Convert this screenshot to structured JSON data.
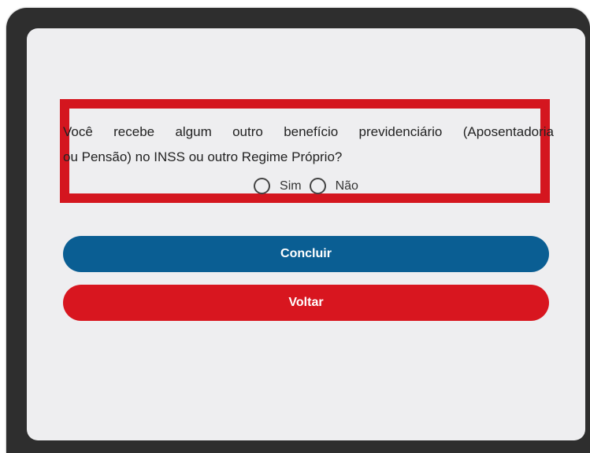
{
  "form": {
    "question_line1": "Você recebe algum outro benefício previdenciário (Aposentadoria",
    "question_line2": "ou Pensão) no INSS ou outro Regime Próprio?",
    "options": [
      {
        "label": "Sim",
        "selected": false
      },
      {
        "label": "Não",
        "selected": false
      }
    ]
  },
  "actions": {
    "submit_label": "Concluir",
    "back_label": "Voltar"
  },
  "colors": {
    "highlight_border": "#d4161f",
    "primary_button": "#0a5e93",
    "secondary_button": "#d8161f",
    "screen_background": "#eeeef0",
    "device_frame": "#2e2e2e"
  }
}
